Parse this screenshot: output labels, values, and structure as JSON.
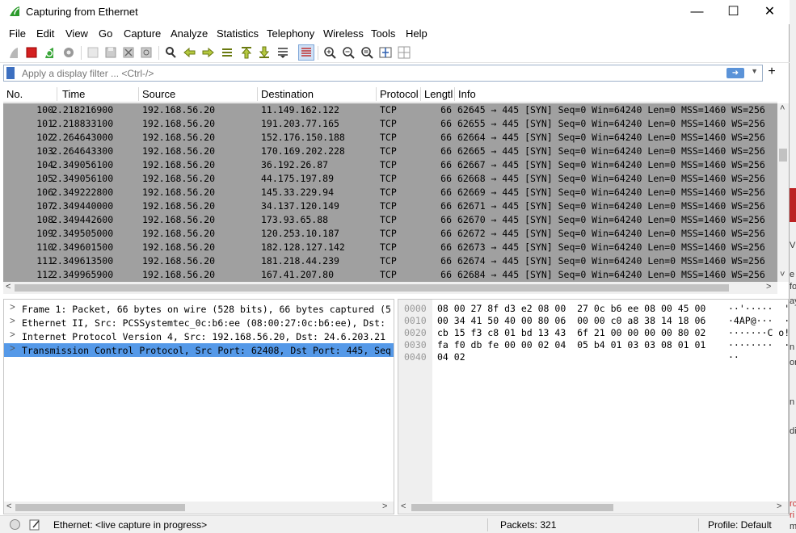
{
  "window": {
    "title": "Capturing from Ethernet"
  },
  "menu": [
    "File",
    "Edit",
    "View",
    "Go",
    "Capture",
    "Analyze",
    "Statistics",
    "Telephony",
    "Wireless",
    "Tools",
    "Help"
  ],
  "filter": {
    "placeholder": "Apply a display filter ... <Ctrl-/>"
  },
  "columns": [
    "No.",
    "Time",
    "Source",
    "Destination",
    "Protocol",
    "Lengtl",
    "Info"
  ],
  "packets": [
    {
      "no": "100",
      "time": "2.218216900",
      "src": "192.168.56.20",
      "dst": "11.149.162.122",
      "proto": "TCP",
      "len": "66",
      "info": "62645 → 445 [SYN] Seq=0 Win=64240 Len=0 MSS=1460 WS=256"
    },
    {
      "no": "101",
      "time": "2.218833100",
      "src": "192.168.56.20",
      "dst": "191.203.77.165",
      "proto": "TCP",
      "len": "66",
      "info": "62655 → 445 [SYN] Seq=0 Win=64240 Len=0 MSS=1460 WS=256"
    },
    {
      "no": "102",
      "time": "2.264643000",
      "src": "192.168.56.20",
      "dst": "152.176.150.188",
      "proto": "TCP",
      "len": "66",
      "info": "62664 → 445 [SYN] Seq=0 Win=64240 Len=0 MSS=1460 WS=256"
    },
    {
      "no": "103",
      "time": "2.264643300",
      "src": "192.168.56.20",
      "dst": "170.169.202.228",
      "proto": "TCP",
      "len": "66",
      "info": "62665 → 445 [SYN] Seq=0 Win=64240 Len=0 MSS=1460 WS=256"
    },
    {
      "no": "104",
      "time": "2.349056100",
      "src": "192.168.56.20",
      "dst": "36.192.26.87",
      "proto": "TCP",
      "len": "66",
      "info": "62667 → 445 [SYN] Seq=0 Win=64240 Len=0 MSS=1460 WS=256"
    },
    {
      "no": "105",
      "time": "2.349056100",
      "src": "192.168.56.20",
      "dst": "44.175.197.89",
      "proto": "TCP",
      "len": "66",
      "info": "62668 → 445 [SYN] Seq=0 Win=64240 Len=0 MSS=1460 WS=256"
    },
    {
      "no": "106",
      "time": "2.349222800",
      "src": "192.168.56.20",
      "dst": "145.33.229.94",
      "proto": "TCP",
      "len": "66",
      "info": "62669 → 445 [SYN] Seq=0 Win=64240 Len=0 MSS=1460 WS=256"
    },
    {
      "no": "107",
      "time": "2.349440000",
      "src": "192.168.56.20",
      "dst": "34.137.120.149",
      "proto": "TCP",
      "len": "66",
      "info": "62671 → 445 [SYN] Seq=0 Win=64240 Len=0 MSS=1460 WS=256"
    },
    {
      "no": "108",
      "time": "2.349442600",
      "src": "192.168.56.20",
      "dst": "173.93.65.88",
      "proto": "TCP",
      "len": "66",
      "info": "62670 → 445 [SYN] Seq=0 Win=64240 Len=0 MSS=1460 WS=256"
    },
    {
      "no": "109",
      "time": "2.349505000",
      "src": "192.168.56.20",
      "dst": "120.253.10.187",
      "proto": "TCP",
      "len": "66",
      "info": "62672 → 445 [SYN] Seq=0 Win=64240 Len=0 MSS=1460 WS=256"
    },
    {
      "no": "110",
      "time": "2.349601500",
      "src": "192.168.56.20",
      "dst": "182.128.127.142",
      "proto": "TCP",
      "len": "66",
      "info": "62673 → 445 [SYN] Seq=0 Win=64240 Len=0 MSS=1460 WS=256"
    },
    {
      "no": "111",
      "time": "2.349613500",
      "src": "192.168.56.20",
      "dst": "181.218.44.239",
      "proto": "TCP",
      "len": "66",
      "info": "62674 → 445 [SYN] Seq=0 Win=64240 Len=0 MSS=1460 WS=256"
    },
    {
      "no": "112",
      "time": "2.349965900",
      "src": "192.168.56.20",
      "dst": "167.41.207.80",
      "proto": "TCP",
      "len": "66",
      "info": "62684 → 445 [SYN] Seq=0 Win=64240 Len=0 MSS=1460 WS=256"
    }
  ],
  "details": [
    "Frame 1: Packet, 66 bytes on wire (528 bits), 66 bytes captured (5",
    "Ethernet II, Src: PCSSystemtec_0c:b6:ee (08:00:27:0c:b6:ee), Dst: ",
    "Internet Protocol Version 4, Src: 192.168.56.20, Dst: 24.6.203.21",
    "Transmission Control Protocol, Src Port: 62408, Dst Port: 445, Seq"
  ],
  "bytes": [
    {
      "off": "0000",
      "hex": "08 00 27 8f d3 e2 08 00  27 0c b6 ee 08 00 45 00",
      "asc": "··'·····  '·"
    },
    {
      "off": "0010",
      "hex": "00 34 41 50 40 00 80 06  00 00 c0 a8 38 14 18 06",
      "asc": "·4AP@···  ··"
    },
    {
      "off": "0020",
      "hex": "cb 15 f3 c8 01 bd 13 43  6f 21 00 00 00 00 80 02",
      "asc": "·······C o!"
    },
    {
      "off": "0030",
      "hex": "fa f0 db fe 00 00 02 04  05 b4 01 03 03 08 01 01",
      "asc": "········  ··"
    },
    {
      "off": "0040",
      "hex": "04 02",
      "asc": "··"
    }
  ],
  "status": {
    "capture": "Ethernet: <live capture in progress>",
    "packets": "Packets: 321",
    "profile": "Profile: Default"
  },
  "background": [
    "VI",
    "e",
    "fo",
    "ay",
    "n",
    "or",
    "n",
    "di",
    "rc",
    "ri",
    "me"
  ]
}
